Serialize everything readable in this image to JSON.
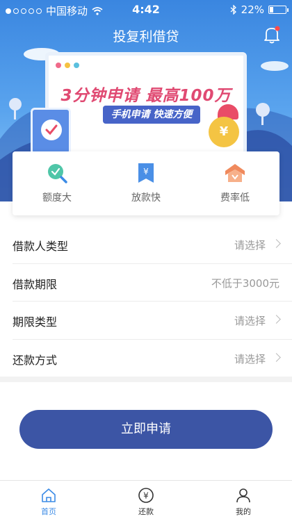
{
  "status_bar": {
    "carrier": "中国移动",
    "time": "4:42",
    "battery": "22%",
    "battery_level": 0.22
  },
  "header": {
    "title": "投复利借贷"
  },
  "banner": {
    "slogan": "3分钟申请 最高100万",
    "tagline": "手机申请 快速方便",
    "coin_symbol": "¥"
  },
  "features": [
    {
      "label": "额度大",
      "icon": "search-check-icon",
      "color": "#4fc6a8"
    },
    {
      "label": "放款快",
      "icon": "yen-bookmark-icon",
      "color": "#4a8fe6"
    },
    {
      "label": "费率低",
      "icon": "house-badge-icon",
      "color": "#f08a5d"
    }
  ],
  "form": {
    "rows": [
      {
        "label": "借款人类型",
        "value": "请选择",
        "arrow": true
      },
      {
        "label": "借款期限",
        "value": "不低于3000元",
        "arrow": false
      },
      {
        "label": "期限类型",
        "value": "请选择",
        "arrow": true
      },
      {
        "label": "还款方式",
        "value": "请选择",
        "arrow": true
      }
    ]
  },
  "apply_button": {
    "label": "立即申请"
  },
  "tab_bar": {
    "tabs": [
      {
        "label": "首页",
        "icon": "home-icon",
        "active": true
      },
      {
        "label": "还款",
        "icon": "yen-circle-icon",
        "active": false
      },
      {
        "label": "我的",
        "icon": "user-icon",
        "active": false
      }
    ]
  },
  "colors": {
    "primary": "#3c55a5",
    "accent": "#3b8be6",
    "slogan": "#e04a72"
  }
}
